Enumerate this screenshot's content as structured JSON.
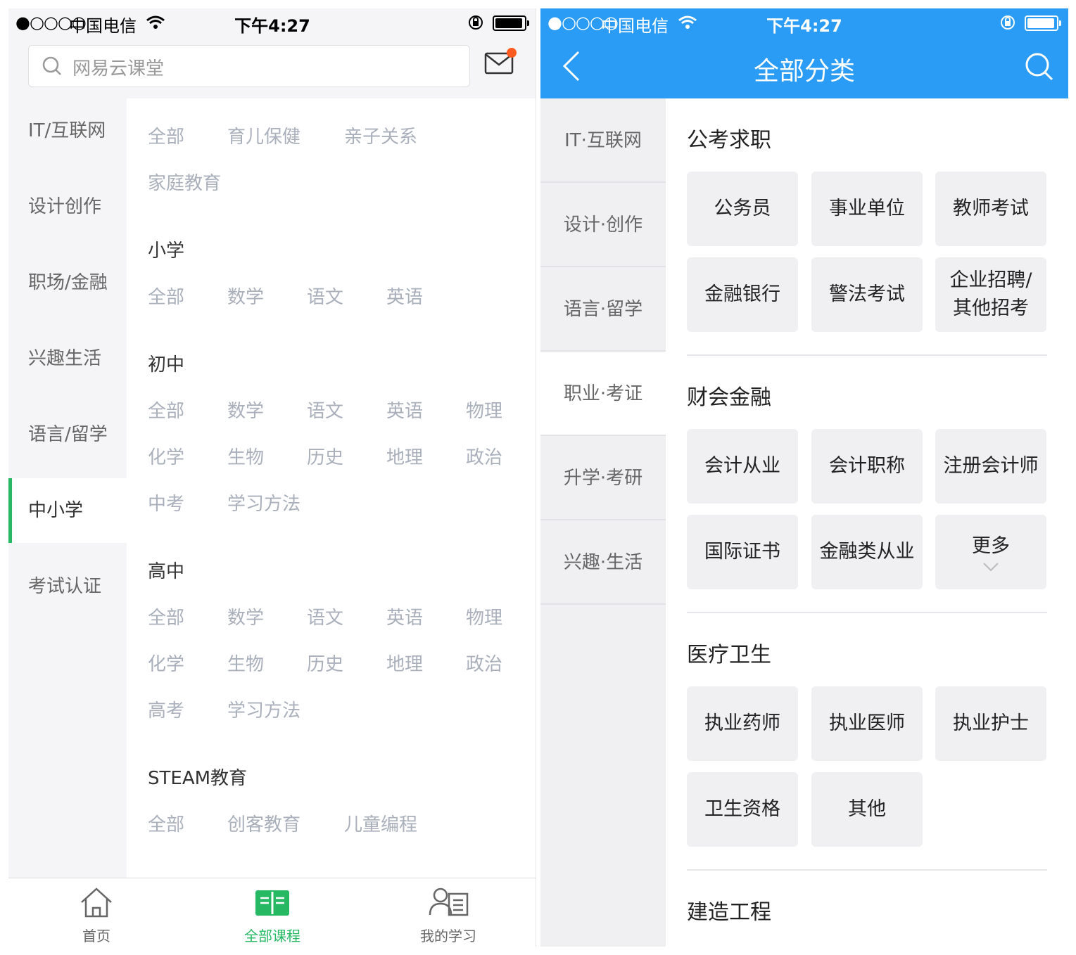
{
  "left": {
    "status": {
      "signal": "●○○○○",
      "carrier": "中国电信",
      "time": "下午4:27"
    },
    "search": {
      "placeholder": "网易云课堂"
    },
    "nav": [
      "IT/互联网",
      "设计创作",
      "职场/金融",
      "兴趣生活",
      "语言/留学",
      "中小学",
      "考试认证"
    ],
    "nav_active": "中小学",
    "content": {
      "top_tags": [
        "全部",
        "育儿保健",
        "亲子关系",
        "家庭教育"
      ],
      "sections": [
        {
          "title": "小学",
          "tags": [
            "全部",
            "数学",
            "语文",
            "英语"
          ]
        },
        {
          "title": "初中",
          "tags": [
            "全部",
            "数学",
            "语文",
            "英语",
            "物理",
            "化学",
            "生物",
            "历史",
            "地理",
            "政治",
            "中考",
            "学习方法"
          ]
        },
        {
          "title": "高中",
          "tags": [
            "全部",
            "数学",
            "语文",
            "英语",
            "物理",
            "化学",
            "生物",
            "历史",
            "地理",
            "政治",
            "高考",
            "学习方法"
          ]
        },
        {
          "title": "STEAM教育",
          "tags": [
            "全部",
            "创客教育",
            "儿童编程"
          ]
        }
      ]
    },
    "tabs": [
      {
        "label": "首页",
        "icon": "home-icon"
      },
      {
        "label": "全部课程",
        "icon": "book-icon"
      },
      {
        "label": "我的学习",
        "icon": "profile-list-icon"
      }
    ],
    "accent": "#26b863"
  },
  "right": {
    "status": {
      "signal": "●○○○○",
      "carrier": "中国电信",
      "time": "下午4:27"
    },
    "title": "全部分类",
    "nav": [
      "IT·互联网",
      "设计·创作",
      "语言·留学",
      "职业·考证",
      "升学·考研",
      "兴趣·生活"
    ],
    "nav_active": "职业·考证",
    "sections": [
      {
        "title": "公考求职",
        "items": [
          "公务员",
          "事业单位",
          "教师考试",
          "金融银行",
          "警法考试",
          "企业招聘/其他招考"
        ]
      },
      {
        "title": "财会金融",
        "items": [
          "会计从业",
          "会计职称",
          "注册会计师",
          "国际证书",
          "金融类从业",
          "更多"
        ]
      },
      {
        "title": "医疗卫生",
        "items": [
          "执业药师",
          "执业医师",
          "执业护士",
          "卫生资格",
          "其他"
        ]
      },
      {
        "title": "建造工程",
        "items": []
      }
    ],
    "accent": "#2b9cf6"
  }
}
